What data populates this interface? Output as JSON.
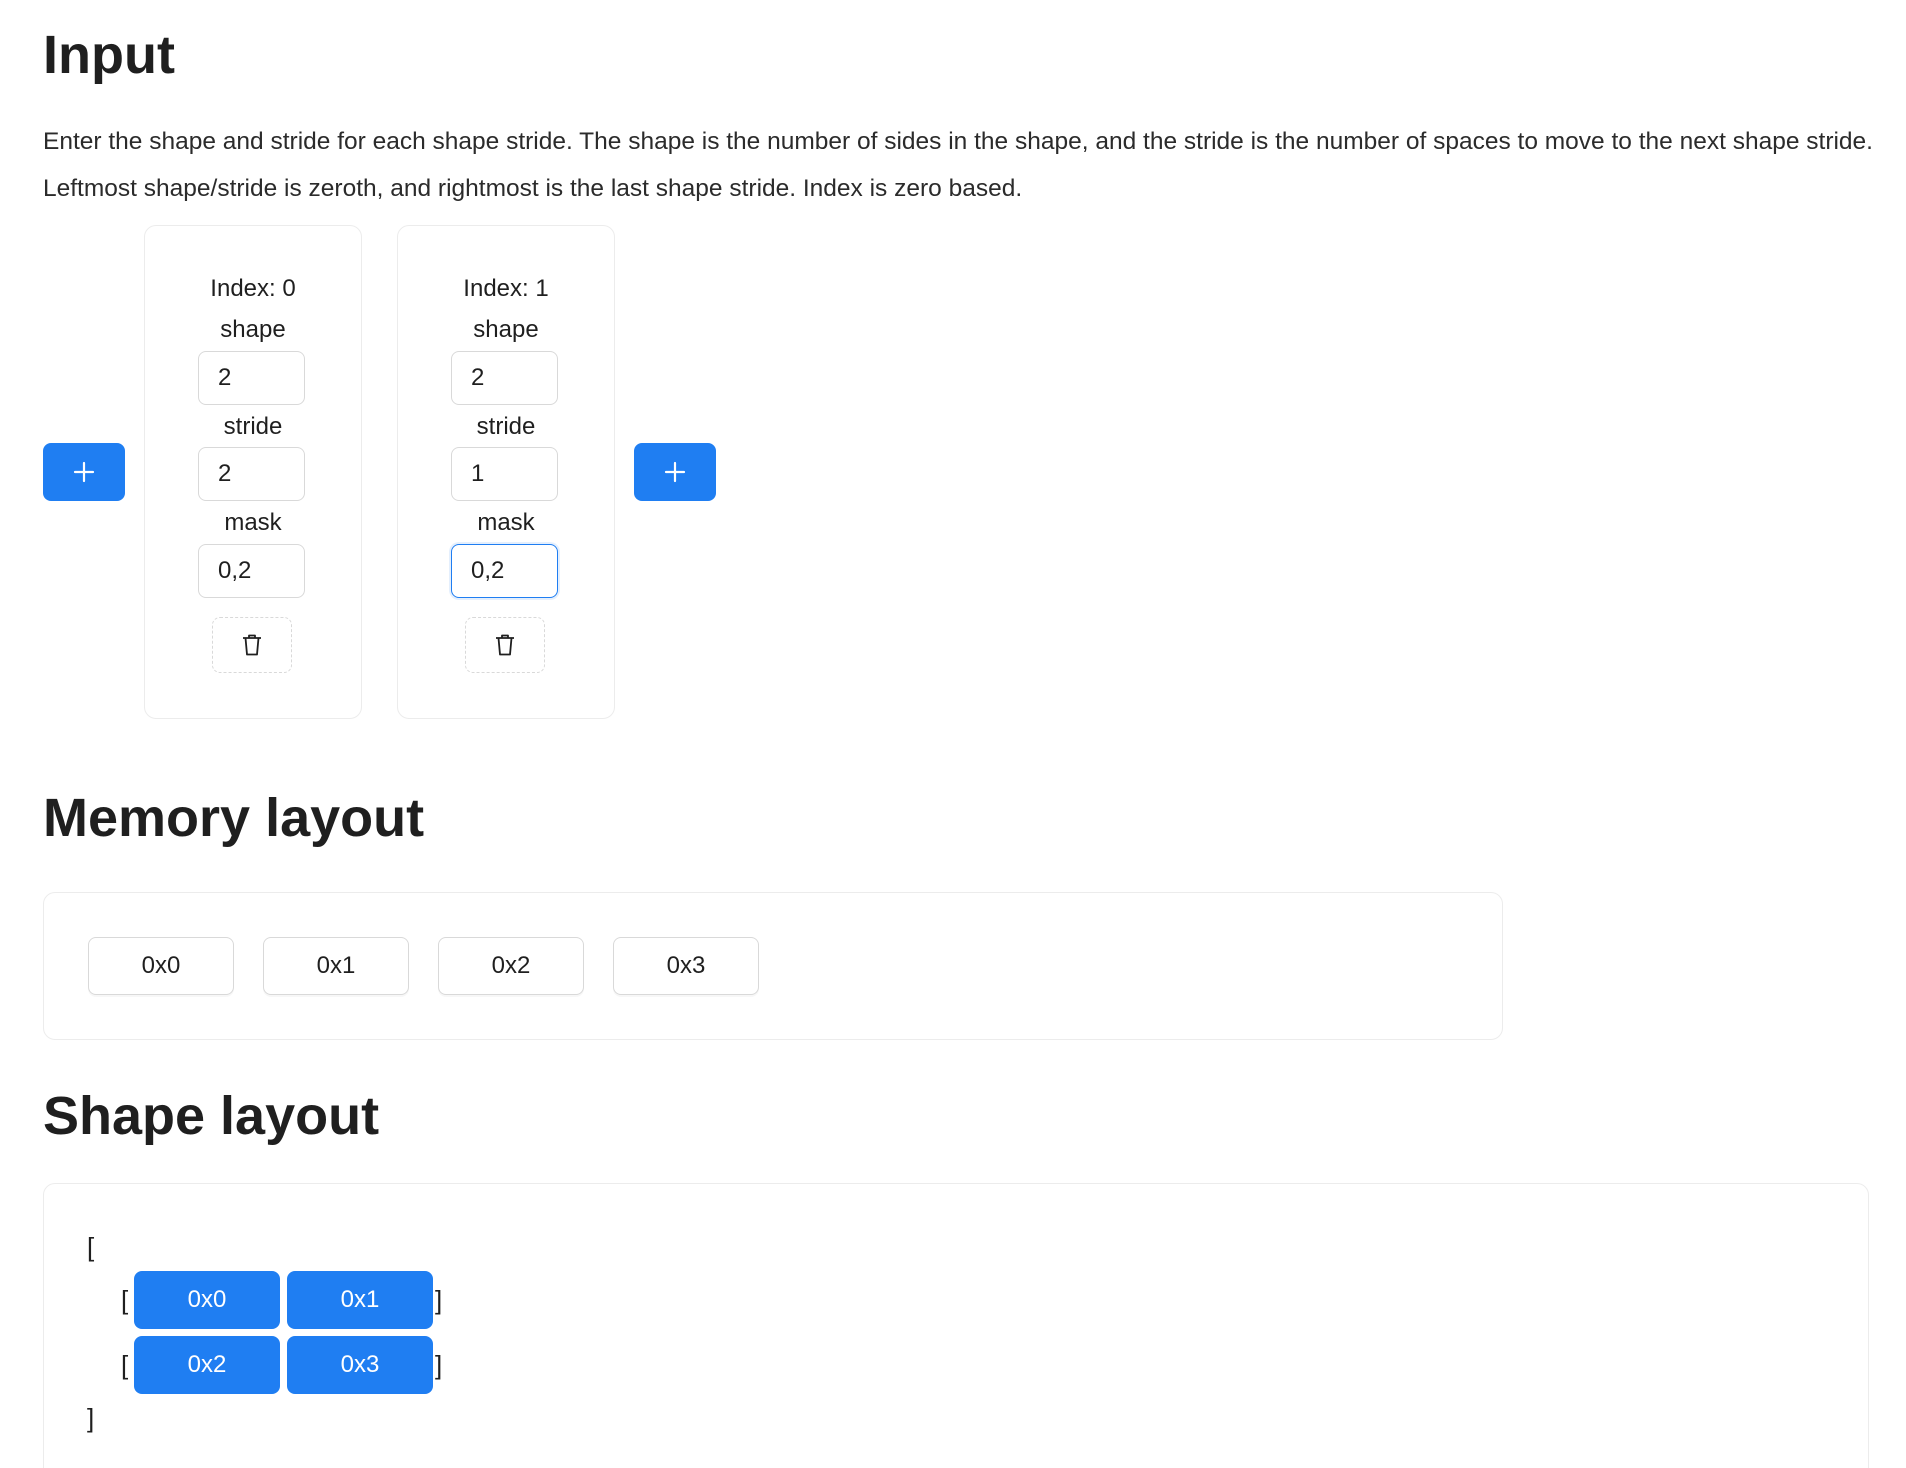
{
  "input": {
    "title": "Input",
    "description": "Enter the shape and stride for each shape stride. The shape is the number of sides in the shape, and the stride is the number of spaces to move to the next shape stride. Leftmost shape/stride is zeroth, and rightmost is the last shape stride. Index is zero based.",
    "add_icon": "plus-icon",
    "delete_icon": "trash-icon",
    "labels": {
      "shape": "shape",
      "stride": "stride",
      "mask": "mask"
    },
    "cards": [
      {
        "index_label": "Index: 0",
        "shape": "2",
        "stride": "2",
        "mask": "0,2"
      },
      {
        "index_label": "Index: 1",
        "shape": "2",
        "stride": "1",
        "mask": "0,2"
      }
    ]
  },
  "memory_layout": {
    "title": "Memory layout",
    "cells": [
      "0x0",
      "0x1",
      "0x2",
      "0x3"
    ]
  },
  "shape_layout": {
    "title": "Shape layout",
    "open_bracket": "[",
    "close_bracket": "]",
    "rows": [
      [
        "0x0",
        "0x1"
      ],
      [
        "0x2",
        "0x3"
      ]
    ]
  },
  "colors": {
    "accent": "#1f7ef2",
    "border": "#d9d9d9",
    "text": "#1f1f1f"
  }
}
